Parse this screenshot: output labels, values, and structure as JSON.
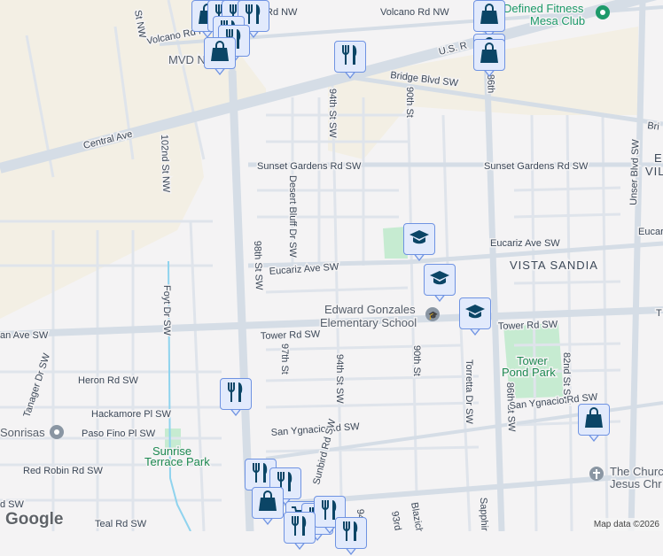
{
  "map": {
    "roads": {
      "central_ave": "Central Ave",
      "us_route": "U.S. R",
      "bridge_blvd": "Bridge Blvd SW",
      "bridge_blvd_right": "Bri",
      "volcano_rd_left": "Volcano Rd NW",
      "volcano_rd_right": "Volcano Rd NW",
      "rd_nw_top": "Rd NW",
      "st_nw_top": "St NW",
      "st_102nd": "102nd St NW",
      "sunset_gardens_left": "Sunset Gardens Rd SW",
      "sunset_gardens_right": "Sunset Gardens Rd SW",
      "desert_bluff": "Desert Bluff Dr SW",
      "eucariz_left": "Eucariz Ave SW",
      "eucariz_right": "Eucariz Ave SW",
      "eucariz_far": "Eucar",
      "st_98th": "98th St SW",
      "st_94th_top": "94th St SW",
      "st_90th_top": "90th St",
      "st_86th_top": "86th",
      "foyt_dr": "Foyt Dr SW",
      "tower_rd_left": "Tower Rd SW",
      "tower_rd_right": "Tower Rd SW",
      "tower_rd_far": "T",
      "an_ave": "an Ave SW",
      "tanager": "Tanager Dr SW",
      "heron": "Heron Rd SW",
      "hackamore": "Hackamore Pl SW",
      "paso_fino": "Paso Fino Pl SW",
      "red_robin": "Red Robin Rd SW",
      "rd_sw_left": "d SW",
      "teal": "Teal Rd SW",
      "st_97th": "97th St",
      "st_94th": "94th St SW",
      "st_90th": "90th St",
      "torretta": "Torretta Dr SW",
      "st_86th": "86th St SW",
      "st_82nd": "82nd St SW",
      "san_ygnacio_left": "San Ygnacio Rd SW",
      "san_ygnacio_right": "San Ygnacio Rd SW",
      "sunbird": "Sunbird Rd SW",
      "rd_93rd": "93rd",
      "blazich": "Blazich",
      "sapphire": "Sapphire",
      "unser": "Unser Blvd SW",
      "rd_94_bottom": "94"
    },
    "places": {
      "mvd": "MVD N",
      "defined_fitness": "Defined Fitness Mesa Club",
      "defined_fitness_l1": "Defined Fitness",
      "defined_fitness_l2": "Mesa Club",
      "vista_sandia": "VISTA SANDIA",
      "vista_partial_1": "E",
      "vista_partial_2": "VIL",
      "school_l1": "Edward Gonzales",
      "school_l2": "Elementary School",
      "tower_pond_l1": "Tower",
      "tower_pond_l2": "Pond Park",
      "sunrise_l1": "Sunrise",
      "sunrise_l2": "Terrace Park",
      "sonrisas": "Sonrisas",
      "church_l1": "The Church",
      "church_l2": "Jesus Chr"
    },
    "logo": "Google",
    "attribution": "Map data ©2026"
  },
  "colors": {
    "background": "#f4f3f4",
    "road": "#d7dee7",
    "beige": "#f3efe4",
    "park": "#c6ebd1",
    "marker_fill": "#e2eafc",
    "marker_border": "#6f93e2",
    "marker_icon": "#0b4566"
  }
}
